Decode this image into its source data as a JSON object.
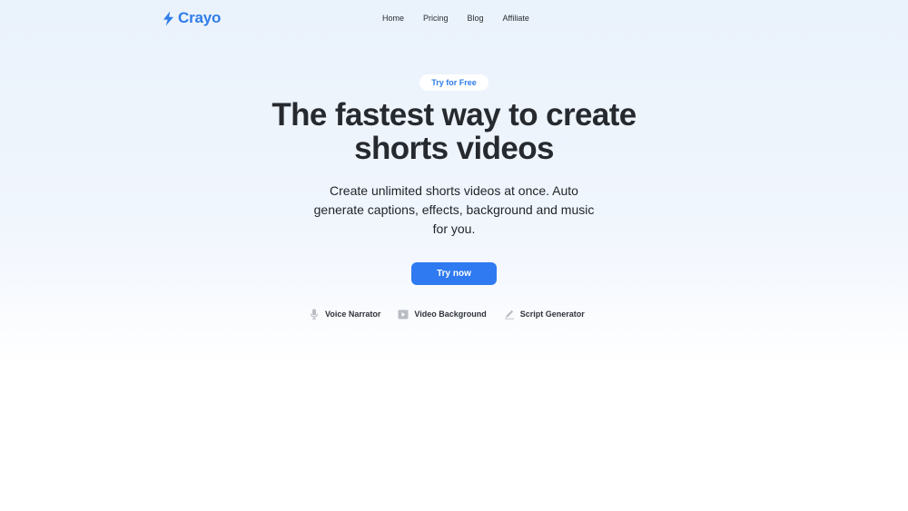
{
  "nav": {
    "brand": "Crayo",
    "links": [
      "Home",
      "Pricing",
      "Blog",
      "Affiliate"
    ]
  },
  "hero": {
    "badge": "Try for Free",
    "headline_line1": "The fastest way to create",
    "headline_line2": "shorts videos",
    "subtext_line1": "Create unlimited shorts videos at once. Auto",
    "subtext_line2": "generate captions, effects, background and music",
    "subtext_line3": "for you.",
    "cta": "Try now"
  },
  "features": [
    {
      "label": "Voice Narrator",
      "icon": "microphone-icon"
    },
    {
      "label": "Video Background",
      "icon": "play-icon"
    },
    {
      "label": "Script Generator",
      "icon": "pencil-icon"
    }
  ],
  "colors": {
    "accent": "#2f7af0",
    "brand": "#2f7de8",
    "text": "#262a2f"
  }
}
